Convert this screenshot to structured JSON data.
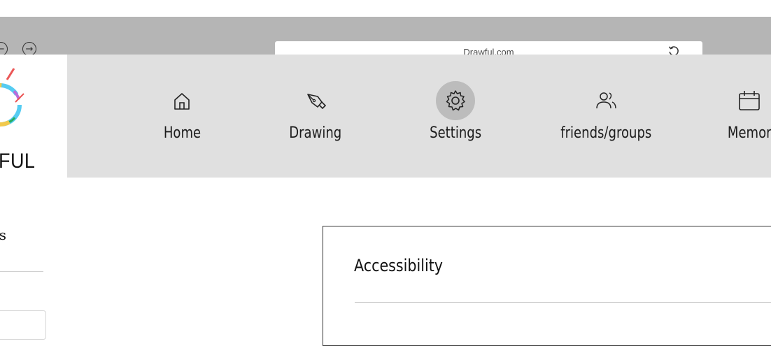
{
  "browser": {
    "back_symbol": "←",
    "forward_symbol": "→",
    "url": "Drawful.com",
    "reload_icon": "reload-icon"
  },
  "logo": {
    "text": "FUL",
    "colors": [
      "#f2c94c",
      "#56ccf2",
      "#eb5757",
      "#bb6bd9",
      "#27ae60"
    ]
  },
  "nav": {
    "items": [
      {
        "label": "Home",
        "icon": "home-icon",
        "active": false
      },
      {
        "label": "Drawing",
        "icon": "pen-icon",
        "active": false
      },
      {
        "label": "Settings",
        "icon": "gear-icon",
        "active": true
      },
      {
        "label": "friends/groups",
        "icon": "users-icon",
        "active": false
      },
      {
        "label": "Memor",
        "icon": "calendar-icon",
        "active": false
      }
    ]
  },
  "sidebar": {
    "heading": "gs"
  },
  "panel": {
    "title": "Accessibility"
  }
}
